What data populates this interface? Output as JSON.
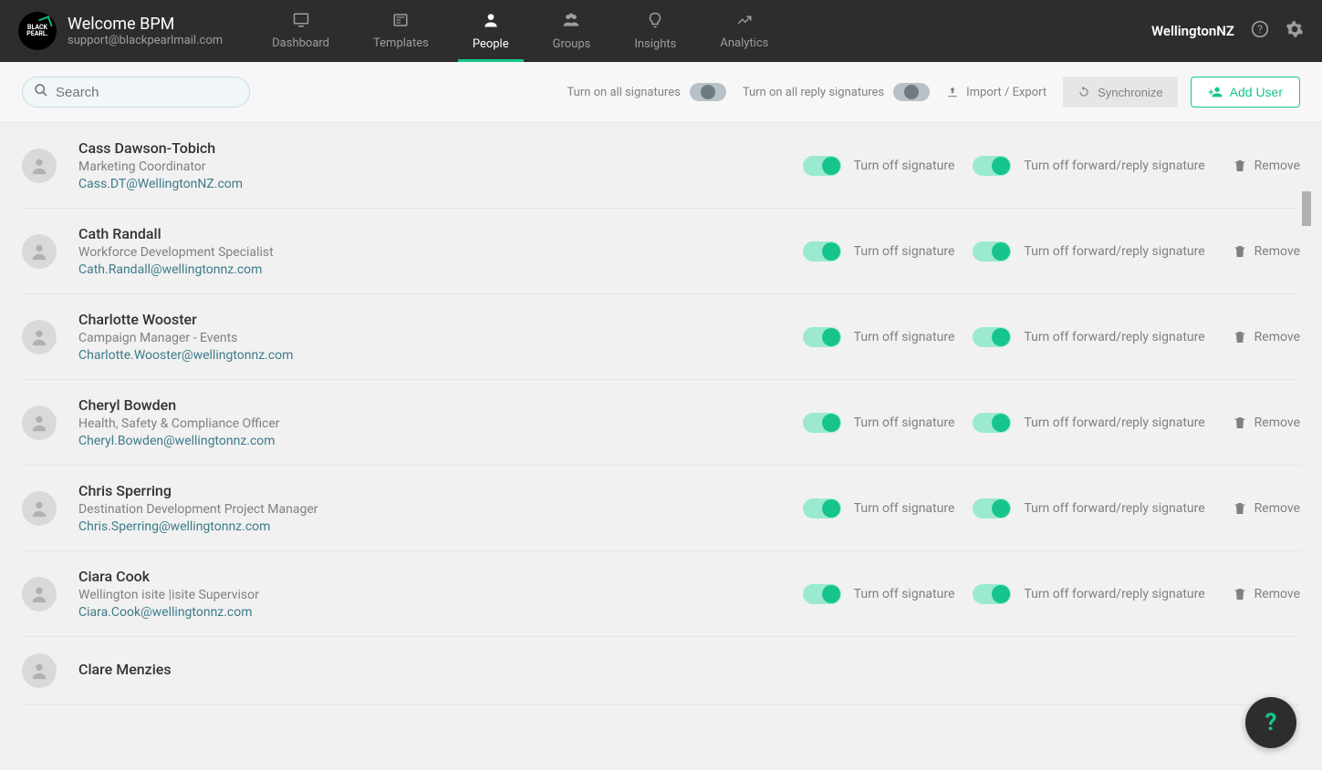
{
  "header": {
    "brand_title": "Welcome BPM",
    "brand_email": "support@blackpearlmail.com",
    "org": "WellingtonNZ",
    "logo_text": "BLACK\nPEARL."
  },
  "nav": [
    {
      "label": "Dashboard",
      "icon": "monitor"
    },
    {
      "label": "Templates",
      "icon": "news"
    },
    {
      "label": "People",
      "icon": "user",
      "active": true
    },
    {
      "label": "Groups",
      "icon": "users"
    },
    {
      "label": "Insights",
      "icon": "bulb"
    },
    {
      "label": "Analytics",
      "icon": "chart"
    }
  ],
  "toolbar": {
    "search_placeholder": "Search",
    "all_sig_label": "Turn on all signatures",
    "all_reply_label": "Turn on all reply signatures",
    "import_export": "Import / Export",
    "sync": "Synchronize",
    "add_user": "Add User"
  },
  "row_labels": {
    "sig": "Turn off signature",
    "reply": "Turn off forward/reply signature",
    "remove": "Remove"
  },
  "people": [
    {
      "name": "Cass Dawson-Tobich",
      "title": "Marketing Coordinator",
      "email": "Cass.DT@WellingtonNZ.com"
    },
    {
      "name": "Cath Randall",
      "title": "Workforce Development Specialist",
      "email": "Cath.Randall@wellingtonnz.com"
    },
    {
      "name": "Charlotte Wooster",
      "title": "Campaign Manager - Events",
      "email": "Charlotte.Wooster@wellingtonnz.com"
    },
    {
      "name": "Cheryl Bowden",
      "title": "Health, Safety & Compliance Officer",
      "email": "Cheryl.Bowden@wellingtonnz.com"
    },
    {
      "name": "Chris Sperring",
      "title": "Destination Development Project Manager",
      "email": "Chris.Sperring@wellingtonnz.com"
    },
    {
      "name": "Ciara Cook",
      "title": "Wellington isite |isite Supervisor",
      "email": "Ciara.Cook@wellingtonnz.com"
    },
    {
      "name": "Clare Menzies",
      "title": "",
      "email": ""
    }
  ],
  "help": "?"
}
